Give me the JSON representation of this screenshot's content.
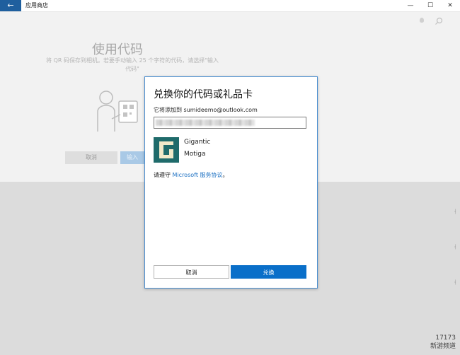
{
  "window": {
    "title": "应用商店",
    "back_glyph": "←",
    "controls": {
      "minimize": "—",
      "maximize": "☐",
      "close": "✕"
    }
  },
  "toolbar": {
    "account_icon": "user-icon",
    "search_icon": "search-icon"
  },
  "background_page": {
    "heading": "使用代码",
    "description": "将 QR 码保存到相机。若要手动输入 25 个字符的代码，请选择\"输入代码\"",
    "cancel_label": "取消",
    "enter_label": "输入"
  },
  "dialog": {
    "title": "兑换你的代码或礼品卡",
    "account_line": "它将添加到 sumideemo@outlook.com",
    "code_input_value": "",
    "product": {
      "name": "Gigantic",
      "publisher": "Motiga"
    },
    "terms_prefix": "请遵守 ",
    "terms_link": "Microsoft 服务协议",
    "terms_suffix": "。",
    "cancel_label": "取消",
    "redeem_label": "兑换"
  },
  "watermark": {
    "line1": "17173",
    "line2": "新游频道"
  },
  "colors": {
    "accent": "#0a6fc9",
    "back_button": "#1f5f9e",
    "game_icon_bg": "#1f6b6b",
    "link": "#1a6fc2"
  }
}
